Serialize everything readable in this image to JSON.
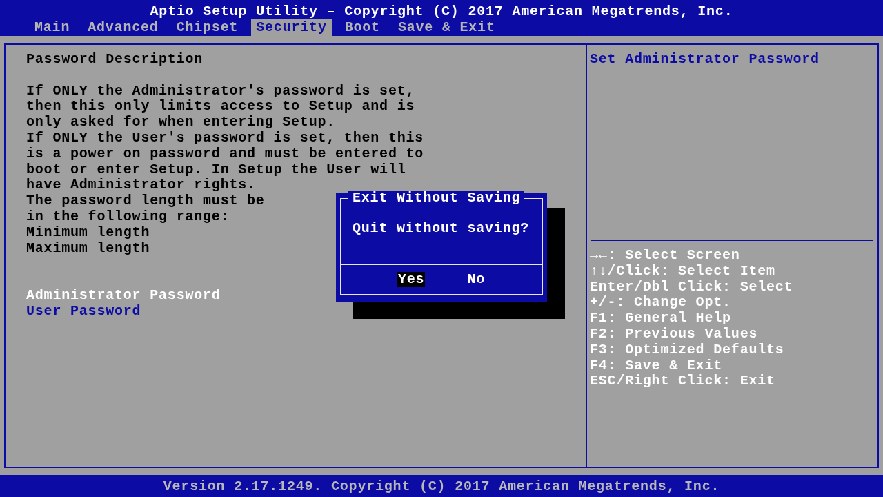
{
  "header": {
    "title": "Aptio Setup Utility – Copyright (C) 2017 American Megatrends, Inc."
  },
  "tabs": [
    {
      "label": "Main",
      "selected": false
    },
    {
      "label": "Advanced",
      "selected": false
    },
    {
      "label": "Chipset",
      "selected": false
    },
    {
      "label": "Security",
      "selected": true
    },
    {
      "label": "Boot",
      "selected": false
    },
    {
      "label": "Save & Exit",
      "selected": false
    }
  ],
  "left_panel": {
    "heading": "Password Description",
    "description_lines": [
      "If ONLY the Administrator's password is set,",
      "then this only limits access to Setup and is",
      "only asked for when entering Setup.",
      "If ONLY the User's password is set, then this",
      "is a power on password and must be entered to",
      "boot or enter Setup. In Setup the User will",
      "have Administrator rights.",
      "The password length must be",
      "in the following range:",
      "Minimum length",
      "Maximum length"
    ],
    "items": [
      {
        "label": "Administrator Password",
        "selected": true
      },
      {
        "label": "User Password",
        "selected": false
      }
    ]
  },
  "right_panel": {
    "help_title": "Set Administrator Password",
    "key_help": [
      "→←: Select Screen",
      "↑↓/Click: Select Item",
      "Enter/Dbl Click: Select",
      "+/-: Change Opt.",
      "F1: General Help",
      "F2: Previous Values",
      "F3: Optimized Defaults",
      "F4: Save & Exit",
      "ESC/Right Click: Exit"
    ]
  },
  "dialog": {
    "title": "Exit Without Saving",
    "message": "Quit without saving?",
    "buttons": [
      {
        "label": "Yes",
        "selected": true
      },
      {
        "label": "No",
        "selected": false
      }
    ]
  },
  "footer": {
    "text": "Version 2.17.1249. Copyright (C) 2017 American Megatrends, Inc."
  }
}
